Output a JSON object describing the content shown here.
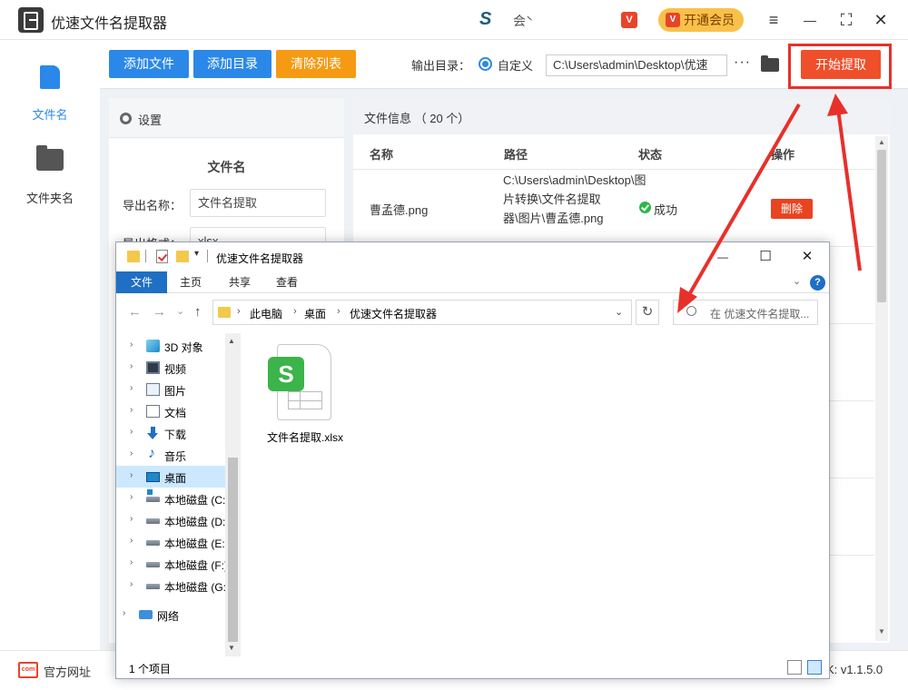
{
  "app": {
    "title": "优速文件名提取器",
    "hui_logo": "S",
    "hui_text": "会̀",
    "vip_small": "V",
    "vip_label": "开通会员",
    "vip_icon": "V"
  },
  "window_controls": {
    "menu": "≡",
    "min": "—",
    "max": "⛶",
    "close": "✕"
  },
  "sidebar": {
    "items": [
      {
        "label": "文件名",
        "active": true
      },
      {
        "label": "文件夹名",
        "active": false
      }
    ]
  },
  "toolbar": {
    "add_file": "添加文件",
    "add_dir": "添加目录",
    "clear_list": "清除列表",
    "output_label": "输出目录：",
    "radio_label": "自定义",
    "output_path": "C:\\Users\\admin\\Desktop\\优速",
    "more": "···",
    "start": "开始提取"
  },
  "settings": {
    "title": "设置",
    "section": "文件名",
    "export_name_label": "导出名称：",
    "export_name_value": "文件名提取",
    "export_format_label": "导出格式：",
    "export_format_value": "xlsx"
  },
  "file_info": {
    "header": "文件信息 （ 20 个）",
    "columns": [
      "名称",
      "路径",
      "状态",
      "操作"
    ],
    "rows": [
      {
        "name": "曹孟德.png",
        "path": "C:\\Users\\admin\\Desktop\\图片转换\\文件名提取器\\图片\\曹孟德.png",
        "status": "成功",
        "action": "删除"
      }
    ]
  },
  "footer": {
    "com_icon": "com",
    "link": "官方网址",
    "version": "K: v1.1.5.0"
  },
  "explorer": {
    "title": "优速文件名提取器",
    "qa_arrow": "▾",
    "controls": {
      "min": "—",
      "max": "☐",
      "close": "✕"
    },
    "ribbon_tabs": [
      "文件",
      "主页",
      "共享",
      "查看"
    ],
    "help": "?",
    "nav": {
      "back": "←",
      "forward": "→",
      "dropdown": "⌄",
      "up": "↑"
    },
    "breadcrumb": [
      "此电脑",
      "桌面",
      "优速文件名提取器"
    ],
    "refresh": "↻",
    "search_placeholder": "在 优速文件名提取...",
    "tree": [
      {
        "label": "3D 对象",
        "icon": "cube-icon",
        "selected": false
      },
      {
        "label": "视频",
        "icon": "video-icon",
        "selected": false
      },
      {
        "label": "图片",
        "icon": "picture-icon",
        "selected": false
      },
      {
        "label": "文档",
        "icon": "document-icon",
        "selected": false
      },
      {
        "label": "下载",
        "icon": "download-icon",
        "selected": false
      },
      {
        "label": "音乐",
        "icon": "music-icon",
        "selected": false
      },
      {
        "label": "桌面",
        "icon": "desktop-icon",
        "selected": true
      },
      {
        "label": "本地磁盘 (C:",
        "icon": "system-disk-icon",
        "selected": false
      },
      {
        "label": "本地磁盘 (D:",
        "icon": "disk-icon",
        "selected": false
      },
      {
        "label": "本地磁盘 (E:",
        "icon": "disk-icon",
        "selected": false
      },
      {
        "label": "本地磁盘 (F:)",
        "icon": "disk-icon",
        "selected": false
      },
      {
        "label": "本地磁盘 (G:",
        "icon": "disk-icon",
        "selected": false
      },
      {
        "label": "网络",
        "icon": "network-icon",
        "selected": false
      }
    ],
    "file": {
      "badge": "S",
      "name": "文件名提取.xlsx"
    },
    "status": "1 个项目"
  },
  "colors": {
    "primary_blue": "#2b88e8",
    "clear_orange": "#f59a12",
    "start_red": "#ef4f2a",
    "highlight_red": "#e8302a",
    "success_green": "#2fb54b",
    "vip_yellow": "#f9c14a",
    "ribbon_blue": "#1f6fc5"
  }
}
